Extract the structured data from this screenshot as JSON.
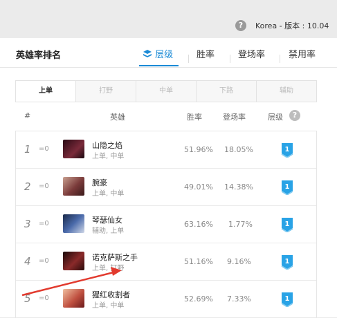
{
  "header": {
    "help_glyph": "?",
    "region_version": "Korea - 版本 : 10.04"
  },
  "card": {
    "title": "英雄率排名",
    "tabs": [
      "层级",
      "胜率",
      "登场率",
      "禁用率"
    ],
    "tab_icon": "layers-icon",
    "accent": "#1a8ad6"
  },
  "lanes": [
    "上单",
    "打野",
    "中单",
    "下路",
    "辅助"
  ],
  "columns": {
    "rank": "#",
    "hero": "英雄",
    "win": "胜率",
    "pick": "登场率",
    "tier": "层级",
    "tier_help": "?"
  },
  "rows": [
    {
      "rank": "1",
      "change": "=0",
      "name": "山隐之焰",
      "role": "上单, 中单",
      "win": "51.96%",
      "pick": "18.05%",
      "tier": "1",
      "portrait_color": "#5a1a2a"
    },
    {
      "rank": "2",
      "change": "=0",
      "name": "腕豪",
      "role": "上单, 中单",
      "win": "49.01%",
      "pick": "14.38%",
      "tier": "1",
      "portrait_color": "#7a3a3a"
    },
    {
      "rank": "3",
      "change": "=0",
      "name": "琴瑟仙女",
      "role": "辅助, 上单",
      "win": "63.16%",
      "pick": "1.77%",
      "tier": "1",
      "portrait_color": "#3a4a7a"
    },
    {
      "rank": "4",
      "change": "=0",
      "name": "诺克萨斯之手",
      "role": "上单, 打野",
      "win": "51.16%",
      "pick": "9.16%",
      "tier": "1",
      "portrait_color": "#6a2020"
    },
    {
      "rank": "5",
      "change": "=0",
      "name": "猩红收割者",
      "role": "上单, 中单",
      "win": "52.69%",
      "pick": "7.33%",
      "tier": "1",
      "portrait_color": "#b04a3a"
    }
  ],
  "tier_badge_color": "#29a3e6",
  "annotation_color": "#e23a2e"
}
